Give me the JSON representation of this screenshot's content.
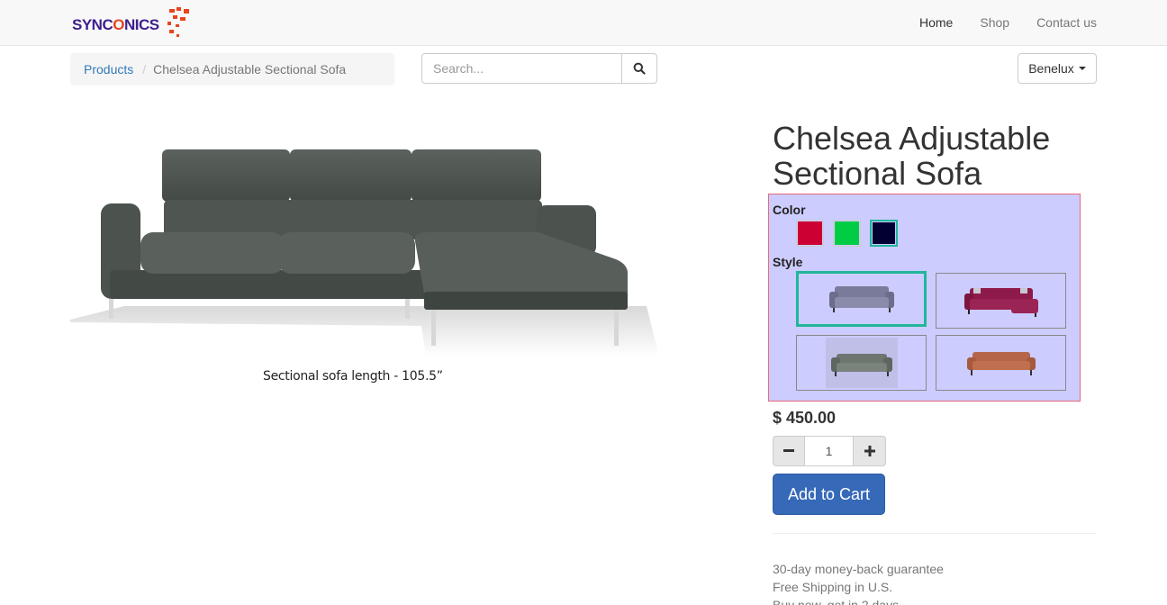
{
  "brand": {
    "name_part1": "SYNC",
    "name_part2": "O",
    "name_part3": "NICS"
  },
  "nav": {
    "items": [
      {
        "label": "Home"
      },
      {
        "label": "Shop"
      },
      {
        "label": "Contact us"
      }
    ]
  },
  "breadcrumb": {
    "parent": "Products",
    "current": "Chelsea Adjustable Sectional Sofa"
  },
  "search": {
    "placeholder": "Search...",
    "value": ""
  },
  "pricelist": {
    "selected": "Benelux"
  },
  "image": {
    "caption": "Sectional sofa length - 105.5”"
  },
  "product": {
    "title": "Chelsea Adjustable Sectional Sofa",
    "price": "$ 450.00",
    "quantity": "1",
    "add_to_cart": "Add to Cart"
  },
  "variants": {
    "color_label": "Color",
    "colors": [
      {
        "name": "red",
        "hex": "#cc0033",
        "selected": false
      },
      {
        "name": "green",
        "hex": "#00cc44",
        "selected": false
      },
      {
        "name": "navy",
        "hex": "#000033",
        "selected": true
      }
    ],
    "style_label": "Style",
    "styles": [
      {
        "name": "grey-lavender-sofa",
        "color": "#7a7a9a",
        "selected": true
      },
      {
        "name": "magenta-sectional",
        "color": "#8e1a4a",
        "selected": false
      },
      {
        "name": "grey-green-sofa",
        "color": "#6e7670",
        "selected": false
      },
      {
        "name": "terracotta-sofa",
        "color": "#b5654a",
        "selected": false
      }
    ]
  },
  "terms": [
    "30-day money-back guarantee",
    "Free Shipping in U.S.",
    "Buy now, get in 2 days"
  ],
  "colors": {
    "accent": "#21b799",
    "primary_button": "#3669b8",
    "variant_bg": "#ccccff"
  }
}
